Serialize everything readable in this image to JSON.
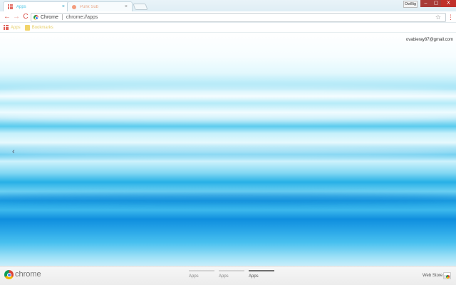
{
  "tabs": [
    {
      "title": "Apps",
      "close": "×",
      "favicon": "apps-grid-icon"
    },
    {
      "title": "Punk Sub",
      "close": "×",
      "favicon": "site-favicon"
    }
  ],
  "window": {
    "user": "OwBig",
    "min": "–",
    "max": "▢",
    "close": "X"
  },
  "toolbar": {
    "back": "←",
    "forward": "→",
    "reload": "C",
    "site_chip": "Chrome",
    "url": "chrome://apps",
    "star": "☆",
    "menu": "⋮"
  },
  "bookmarks": [
    {
      "label": "Apps",
      "icon": "apps-grid-icon"
    },
    {
      "label": "Bookmarks",
      "icon": "folder-icon"
    }
  ],
  "content": {
    "account": "ovabieray87@gmail.com",
    "prev_arrow": "‹"
  },
  "footer": {
    "brand": "chrome",
    "pages": [
      {
        "label": "Apps",
        "active": false
      },
      {
        "label": "Apps",
        "active": false
      },
      {
        "label": "Apps",
        "active": true
      }
    ],
    "webstore": "Web Store"
  },
  "colors": {
    "accent": "#d94c43",
    "water_light": "#e2f8fd",
    "water_deep": "#0f8ede"
  }
}
